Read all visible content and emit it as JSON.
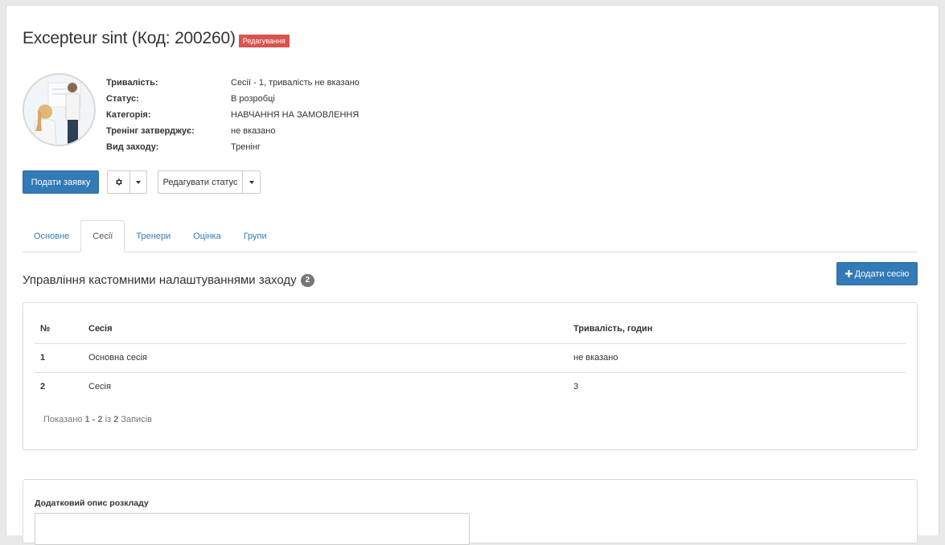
{
  "header": {
    "title": "Excepteur sint (Код: 200260)",
    "status_badge": "Редагування"
  },
  "details": [
    {
      "label": "Тривалість:",
      "value": "Сесії - 1, тривалість не вказано"
    },
    {
      "label": "Статус:",
      "value": "В розробці"
    },
    {
      "label": "Категорія:",
      "value": "НАВЧАННЯ НА ЗАМОВЛЕННЯ"
    },
    {
      "label": "Тренінг затверджує:",
      "value": "не вказано"
    },
    {
      "label": "Вид заходу:",
      "value": "Тренінг"
    }
  ],
  "actions": {
    "submit_label": "Подати заявку",
    "edit_status_label": "Редагувати статус"
  },
  "tabs": [
    {
      "label": "Основне"
    },
    {
      "label": "Сесії"
    },
    {
      "label": "Тренери"
    },
    {
      "label": "Оцінка"
    },
    {
      "label": "Групи"
    }
  ],
  "sessions": {
    "title": "Управління кастомними налаштуваннями заходу",
    "count": "2",
    "add_label": "Додати сесію",
    "columns": [
      "№",
      "Сесія",
      "Тривалість, годин"
    ],
    "rows": [
      {
        "num": "1",
        "name": "Основна сесія",
        "duration": "не вказано"
      },
      {
        "num": "2",
        "name": "Сесія",
        "duration": "3"
      }
    ],
    "summary_prefix": "Показано",
    "summary_range": "1 - 2",
    "summary_of": "із",
    "summary_total": "2",
    "summary_suffix": "Записів"
  },
  "schedule": {
    "label": "Додатковий опис розкладу",
    "value": ""
  },
  "colors": {
    "primary": "#337ab7",
    "danger": "#d9534f",
    "badge": "#777777"
  }
}
